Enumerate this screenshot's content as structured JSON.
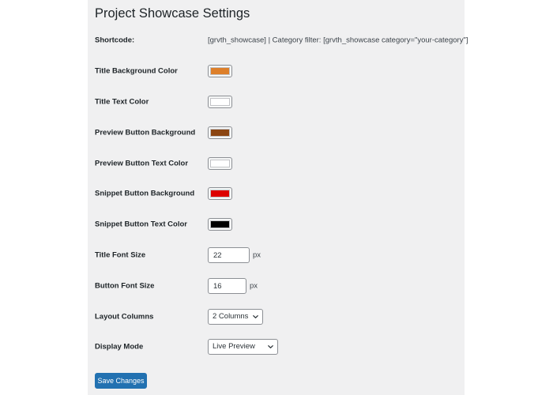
{
  "page": {
    "title": "Project Showcase Settings"
  },
  "shortcode": {
    "label": "Shortcode:",
    "value": "[grvth_showcase] | Category filter: [grvth_showcase category=\"your-category\"]"
  },
  "colors": {
    "title_bg": {
      "label": "Title Background Color",
      "value": "#dd7f2a"
    },
    "title_text": {
      "label": "Title Text Color",
      "value": "#ffffff"
    },
    "preview_bg": {
      "label": "Preview Button Background",
      "value": "#8b4513"
    },
    "preview_text": {
      "label": "Preview Button Text Color",
      "value": "#ffffff"
    },
    "snippet_bg": {
      "label": "Snippet Button Background",
      "value": "#dd0000"
    },
    "snippet_text": {
      "label": "Snippet Button Text Color",
      "value": "#000000"
    }
  },
  "font_sizes": {
    "title": {
      "label": "Title Font Size",
      "value": "22",
      "unit": "px"
    },
    "button": {
      "label": "Button Font Size",
      "value": "16",
      "unit": "px"
    }
  },
  "layout": {
    "columns": {
      "label": "Layout Columns",
      "selected": "2 Columns"
    },
    "display_mode": {
      "label": "Display Mode",
      "selected": "Live Preview"
    }
  },
  "actions": {
    "save_label": "Save Changes"
  },
  "theme": {
    "panel_bg": "#f0f0f1",
    "primary": "#2271b1"
  },
  "icons": {
    "select_arrow": "chevron-down-icon"
  }
}
